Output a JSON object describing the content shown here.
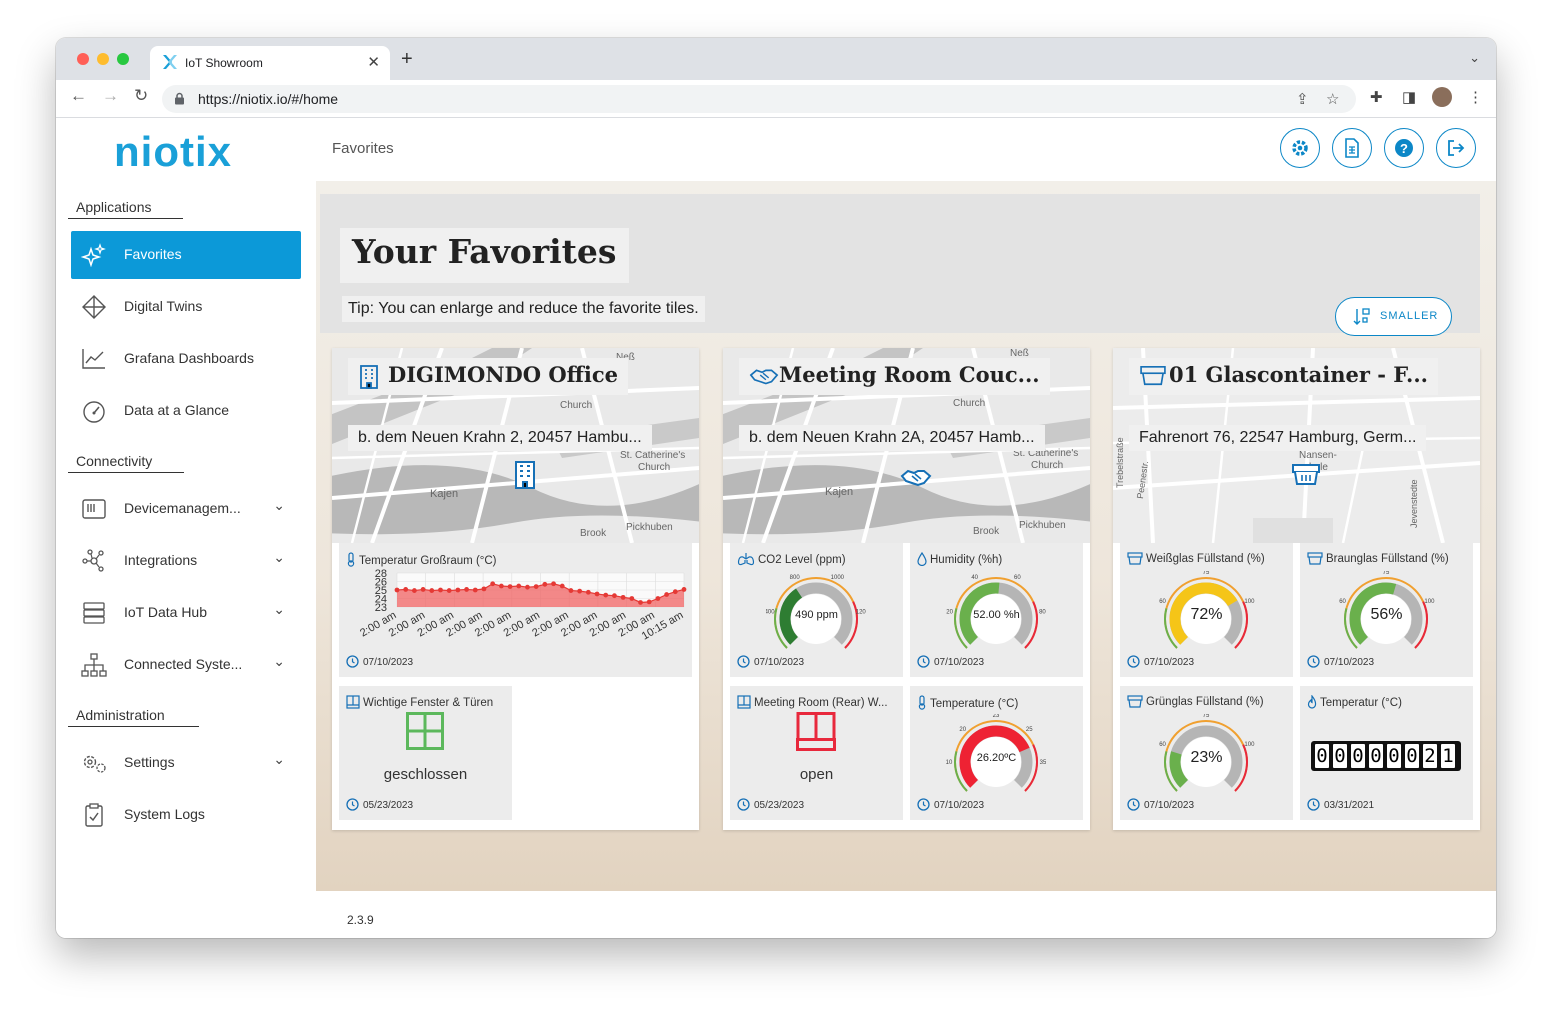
{
  "browser": {
    "tab_title": "IoT Showroom",
    "url_scheme": "https://",
    "url_host": "niotix.io",
    "url_path": "/#/home",
    "new_tab": "+",
    "close_tab": "✕"
  },
  "sidebar": {
    "logo": "niotix",
    "sections": {
      "applications": "Applications",
      "connectivity": "Connectivity",
      "administration": "Administration"
    },
    "items": {
      "favorites": "Favorites",
      "digital_twins": "Digital Twins",
      "grafana": "Grafana Dashboards",
      "glance": "Data at a Glance",
      "devicemanagement": "Devicemanagem...",
      "integrations": "Integrations",
      "iot_data_hub": "IoT Data Hub",
      "connected_systems": "Connected Syste...",
      "settings": "Settings",
      "system_logs": "System Logs"
    }
  },
  "topbar": {
    "breadcrumb": "Favorites"
  },
  "header": {
    "title": "Your Favorites",
    "tip": "Tip: You can enlarge and reduce the favorite tiles.",
    "smaller_label": "SMALLER"
  },
  "map_labels": {
    "nesz": "Neß",
    "church": "Church",
    "st_catherines": "St. Catherine's",
    "kajen": "Kajen",
    "brook": "Brook",
    "pickhuben": "Pickhuben",
    "nansen": "Nansen-",
    "schule": "schule",
    "peenestr": "Peenestr.",
    "trebelstr": "Trebelstraße",
    "jevenstedt": "Jevenstedte"
  },
  "cards": [
    {
      "title": "DIGIMONDO Office",
      "address": "b. dem Neuen Krahn 2, 20457 Hambu...",
      "tiles": [
        {
          "title": "Temperatur Großraum (°C)",
          "date": "07/10/2023"
        },
        {
          "title": "Wichtige Fenster & Türen",
          "state": "geschlossen",
          "date": "05/23/2023"
        }
      ]
    },
    {
      "title": "Meeting Room Couc...",
      "address": "b. dem Neuen Krahn 2A, 20457 Hamb...",
      "tiles": [
        {
          "title": "CO2 Level (ppm)",
          "value_text": "490 ppm",
          "date": "07/10/2023"
        },
        {
          "title": "Humidity (%h)",
          "value_text": "52.00 %h",
          "date": "07/10/2023"
        },
        {
          "title": "Meeting Room (Rear) W...",
          "state": "open",
          "date": "05/23/2023"
        },
        {
          "title": "Temperature (°C)",
          "value_text": "26.20ºC",
          "date": "07/10/2023"
        }
      ]
    },
    {
      "title": "01 Glascontainer - F...",
      "address": "Fahrenort 76, 22547 Hamburg, Germ...",
      "tiles": [
        {
          "title": "Weißglas Füllstand (%)",
          "value_text": "72%",
          "date": "07/10/2023"
        },
        {
          "title": "Braunglas Füllstand (%)",
          "value_text": "56%",
          "date": "07/10/2023"
        },
        {
          "title": "Grünglas Füllstand (%)",
          "value_text": "23%",
          "date": "07/10/2023"
        },
        {
          "title": "Temperatur (°C)",
          "digits": [
            "0",
            "0",
            "0",
            "0",
            "0",
            "0",
            "2",
            "1"
          ],
          "date": "03/31/2021"
        }
      ]
    }
  ],
  "gauges": {
    "co2": {
      "value": 490,
      "min": 0,
      "max": 1300,
      "ticks": [
        "400",
        "800",
        "1000",
        "1200"
      ],
      "color": "#2e7d32"
    },
    "humidity": {
      "value": 52,
      "min": 0,
      "max": 100,
      "ticks": [
        "20",
        "40",
        "60",
        "80"
      ],
      "color": "#6ab04c"
    },
    "temperature": {
      "value": 26.2,
      "min": 0,
      "max": 35,
      "ticks": [
        "10",
        "20",
        "23",
        "25",
        "35"
      ],
      "color": "#ee2233"
    },
    "weissglas": {
      "value": 72,
      "min": 0,
      "max": 100,
      "ticks": [
        "60",
        "75",
        "100"
      ],
      "color": "#f5c518"
    },
    "braunglas": {
      "value": 56,
      "min": 0,
      "max": 100,
      "ticks": [
        "60",
        "75",
        "100"
      ],
      "color": "#6ab04c"
    },
    "gruenglas": {
      "value": 23,
      "min": 0,
      "max": 100,
      "ticks": [
        "60",
        "75",
        "100"
      ],
      "color": "#6ab04c"
    }
  },
  "chart_data": {
    "type": "area",
    "title": "Temperatur Großraum (°C)",
    "y_ticks": [
      "28",
      "26",
      "25",
      "24",
      "23"
    ],
    "ylim": [
      22.5,
      28.5
    ],
    "x_ticks": [
      "2:00 am",
      "2:00 am",
      "2:00 am",
      "2:00 am",
      "2:00 am",
      "2:00 am",
      "2:00 am",
      "2:00 am",
      "2:00 am",
      "2:00 am",
      "10:15 am"
    ],
    "values": [
      25.5,
      25.6,
      25.4,
      25.6,
      25.4,
      25.5,
      25.4,
      25.5,
      25.6,
      25.5,
      25.7,
      26.6,
      26.2,
      26.1,
      26.2,
      26.0,
      26.1,
      26.5,
      26.6,
      26.2,
      25.4,
      25.3,
      25.1,
      24.8,
      24.6,
      24.5,
      24.2,
      24.0,
      23.3,
      23.4,
      24.0,
      24.7,
      25.2,
      25.6
    ],
    "color": "#f06262"
  },
  "footer": {
    "version": "2.3.9"
  }
}
